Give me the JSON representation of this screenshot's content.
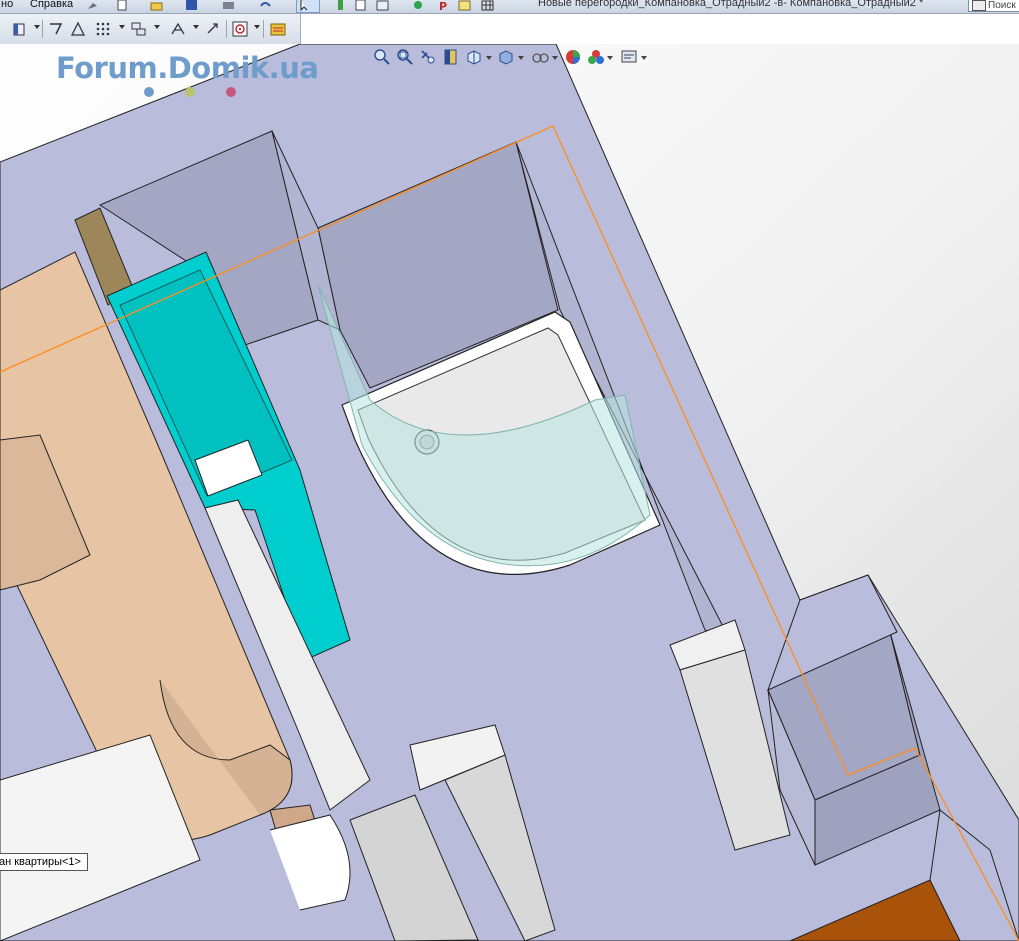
{
  "menu": {
    "item_window_partial": "но",
    "item_help": "Справка"
  },
  "window": {
    "title": "Новые перегородки_Компановка_Отрадный2 -в- Компановка_Отрадный2 *",
    "search_placeholder": "Поиск"
  },
  "watermark": {
    "text": "Forum.Domik.ua",
    "dot_colors": [
      "#6e9dcc",
      "#b9c46a",
      "#c45a7c"
    ]
  },
  "tooltip": {
    "text": "ан квартиры<1>"
  },
  "icons": {
    "menubar": [
      "pin-icon",
      "new-document-icon",
      "open-folder-icon",
      "save-icon",
      "print-icon",
      "undo-icon",
      "select-cursor-icon",
      "rebuild-icon",
      "file-properties-icon",
      "options-icon",
      "record-macro-icon",
      "p-icon",
      "grid-icon"
    ],
    "toolbar2": [
      "view-orientation-icon",
      "draft-icon",
      "warning-icon",
      "grid-dots-icon",
      "component-icon",
      "mate-icon",
      "reference-icon",
      "target-icon",
      "toolbox-icon"
    ],
    "hud": [
      "zoom-to-fit-icon",
      "zoom-area-icon",
      "previous-view-icon",
      "section-view-icon",
      "view-orientation-icon",
      "display-style-icon",
      "hide-show-icon",
      "appearance-icon",
      "scene-icon",
      "view-settings-icon"
    ]
  },
  "colors": {
    "floor": "#b9bddb",
    "wall_cap": "#a4a7c4",
    "cyan_box": "#00cdcd",
    "beige": "#e6c4a4",
    "sketch_line": "#ff8c1a",
    "toolbar_bg": "#dfe6f0"
  }
}
